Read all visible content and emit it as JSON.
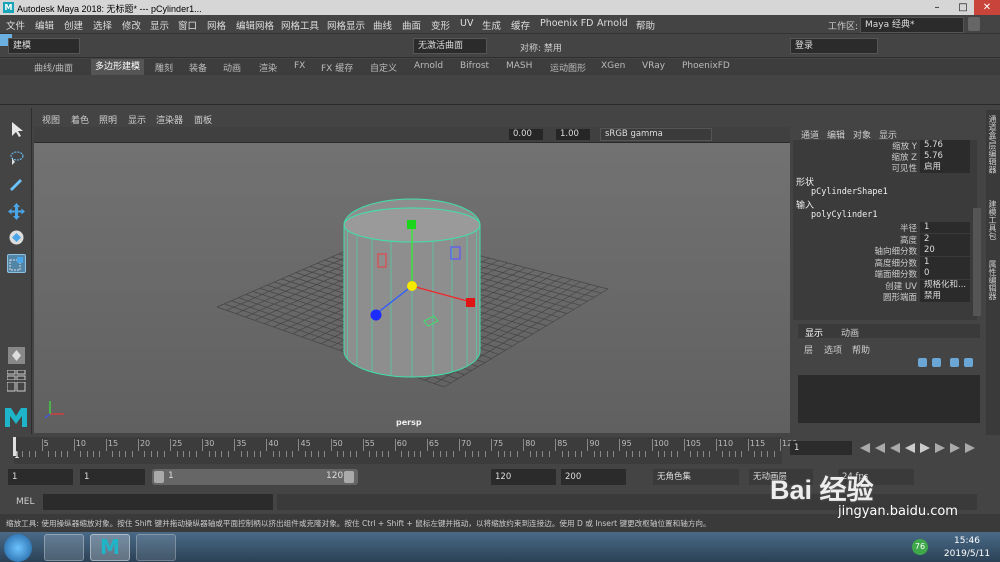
{
  "window": {
    "title": "Autodesk Maya 2018: 无标题*   ---   pCylinder1...",
    "app_icon": "M"
  },
  "menus": [
    "文件",
    "编辑",
    "创建",
    "选择",
    "修改",
    "显示",
    "窗口",
    "网格",
    "编辑网格",
    "网格工具",
    "网格显示",
    "曲线",
    "曲面",
    "变形",
    "UV",
    "生成",
    "缓存",
    "Phoenix FD",
    "Arnold",
    "帮助"
  ],
  "workspace": {
    "label": "工作区:",
    "value": "Maya 经典*"
  },
  "status": {
    "mode": "建模",
    "live": "无激活曲面",
    "symmetry": "对称: 禁用",
    "login": "登录"
  },
  "shelf_tabs": [
    "曲线/曲面",
    "多边形建模",
    "雕刻",
    "装备",
    "动画",
    "渲染",
    "FX",
    "FX 缓存",
    "自定义",
    "Arnold",
    "Bifrost",
    "MASH",
    "运动图形",
    "XGen",
    "VRay",
    "PhoenixFD"
  ],
  "shelf_active_index": 1,
  "viewport": {
    "menus": [
      "视图",
      "着色",
      "照明",
      "显示",
      "渲染器",
      "面板"
    ],
    "exposure": "0.00",
    "gamma": "1.00",
    "colorspace": "sRGB gamma",
    "camera": "persp"
  },
  "channel_box": {
    "menus": [
      "通道",
      "编辑",
      "对象",
      "显示"
    ],
    "top_attrs": [
      {
        "name": "缩放 Y",
        "value": "5.76"
      },
      {
        "name": "缩放 Z",
        "value": "5.76"
      },
      {
        "name": "可见性",
        "value": "启用"
      }
    ],
    "shape_header": "形状",
    "shape_node": "pCylinderShape1",
    "input_header": "输入",
    "input_node": "polyCylinder1",
    "attrs": [
      {
        "name": "半径",
        "value": "1"
      },
      {
        "name": "高度",
        "value": "2"
      },
      {
        "name": "轴向细分数",
        "value": "20"
      },
      {
        "name": "高度细分数",
        "value": "1"
      },
      {
        "name": "端面细分数",
        "value": "0"
      },
      {
        "name": "创建 UV",
        "value": "规格化和..."
      },
      {
        "name": "圆形端面",
        "value": "禁用"
      }
    ]
  },
  "layer_editor": {
    "tabs": [
      "显示",
      "动画"
    ],
    "menus": [
      "层",
      "选项",
      "帮助"
    ]
  },
  "side_tabs": [
    "通道盒/层编辑器",
    "建模工具包",
    "属性编辑器"
  ],
  "timeline": {
    "ticks": [
      "5",
      "10",
      "15",
      "20",
      "25",
      "30",
      "35",
      "40",
      "45",
      "50",
      "55",
      "60",
      "65",
      "70",
      "75",
      "80",
      "85",
      "90",
      "95",
      "100",
      "105",
      "110",
      "115",
      "120"
    ],
    "current_frame": "1",
    "current_field": "1"
  },
  "range": {
    "start": "1",
    "start2": "1",
    "slider_start": "1",
    "slider_end": "120",
    "end": "120",
    "end2": "200",
    "charset": "无角色集",
    "anim_layer": "无动画层",
    "fps": "24 fps"
  },
  "cmd": {
    "label": "MEL"
  },
  "help_text": "缩放工具: 使用操纵器缩放对象。按住 Shift 键并拖动操纵器轴或平面控制柄以挤出组件或克隆对象。按住 Ctrl + Shift + 鼠标左键并拖动，以将缩放约束到连接边。使用 D 或 Insert 键更改枢轴位置和轴方向。",
  "watermark": {
    "text": "Bai 经验",
    "url": "jingyan.baidu.com"
  },
  "taskbar": {
    "time": "15:46",
    "date": "2019/5/11",
    "badge": "76"
  }
}
